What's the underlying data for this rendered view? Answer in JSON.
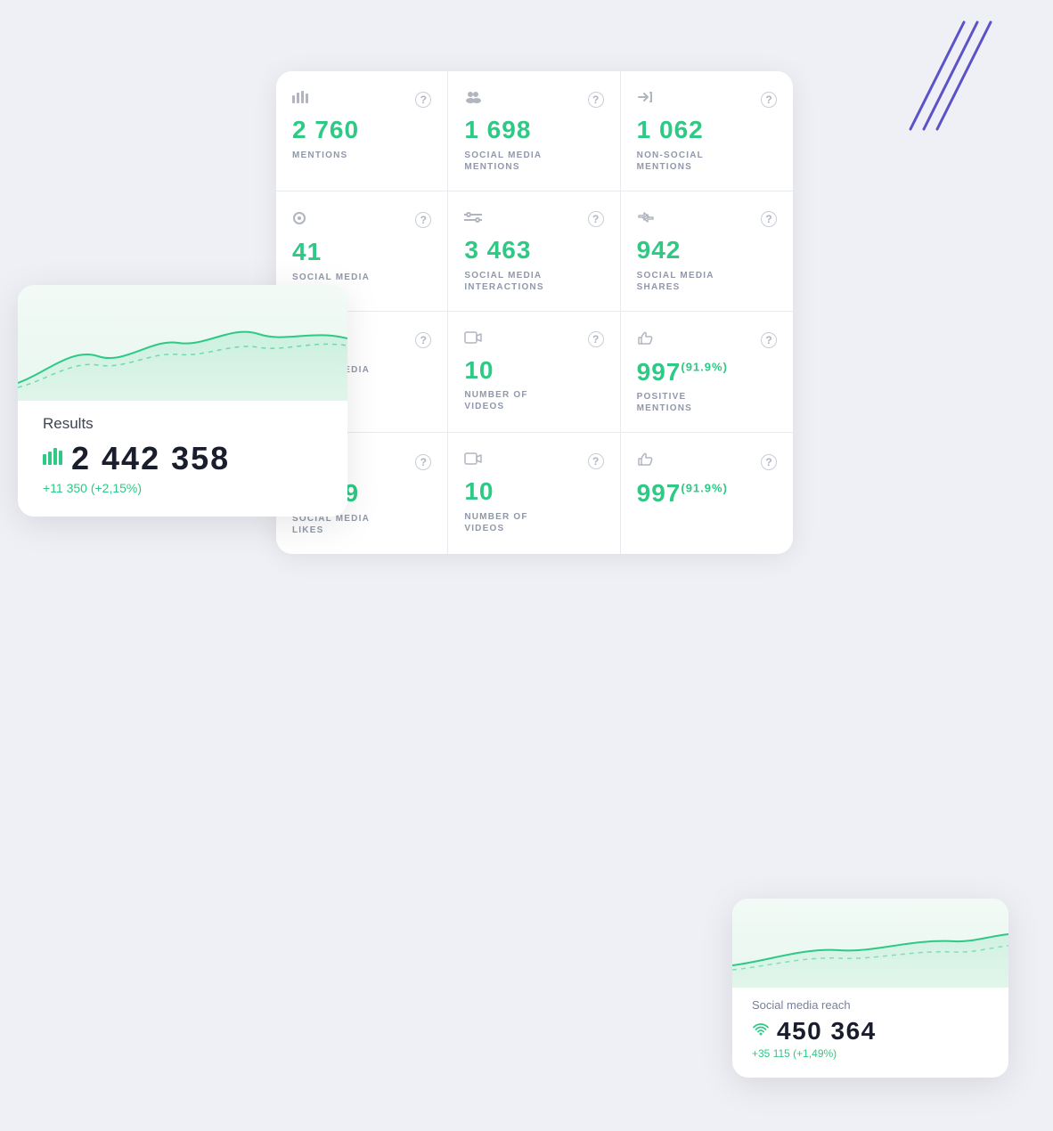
{
  "page": {
    "background_color": "#eef0f6"
  },
  "decorative": {
    "lines_color": "#5b52c8"
  },
  "metrics": [
    {
      "icon": "bar-chart-icon",
      "icon_char": "▦",
      "help": "?",
      "value": "2 760",
      "label": "MENTIONS"
    },
    {
      "icon": "people-icon",
      "icon_char": "👥",
      "help": "?",
      "value": "1 698",
      "label": "SOCIAL MEDIA\nMENTIONS"
    },
    {
      "icon": "share-icon",
      "icon_char": "↗",
      "help": "?",
      "value": "1 062",
      "label": "NON-SOCIAL\nMENTIONS"
    },
    {
      "icon": "circle-icon",
      "icon_char": "◎",
      "help": "?",
      "value": "41",
      "label": "SOCIAL MEDIA",
      "partial": true
    },
    {
      "icon": "filter-icon",
      "icon_char": "⇌",
      "help": "?",
      "value": "3 463",
      "label": "SOCIAL MEDIA\nINTERACTIONS"
    },
    {
      "icon": "retweet-icon",
      "icon_char": "↻",
      "help": "?",
      "value": "942",
      "label": "SOCIAL MEDIA\nSHARES"
    },
    {
      "icon": "dot-icon",
      "icon_char": "•",
      "help": "?",
      "value": "...",
      "label": "SOCIAL MEDIA",
      "partial": true
    },
    {
      "icon": "video-icon",
      "icon_char": "▶",
      "help": "?",
      "value": "10",
      "label": "NUMBER OF\nVIDEOS"
    },
    {
      "icon": "thumb-icon",
      "icon_char": "👍",
      "help": "?",
      "value": "997",
      "value_sup": "(91.9%)",
      "label": "POSITIVE\nMENTIONS"
    },
    {
      "icon": "star-icon",
      "icon_char": "★",
      "help": "?",
      "value": "2 519",
      "label": "SOCIAL MEDIA\nLIKES"
    },
    {
      "icon": "video2-icon",
      "icon_char": "▶",
      "help": "?",
      "value": "10",
      "label": "NUMBER OF\nVIDEOS"
    },
    {
      "icon": "thumb2-icon",
      "icon_char": "👍",
      "help": "?",
      "value": "997",
      "value_sup": "(91.9%)",
      "label": ""
    }
  ],
  "results_widget": {
    "title": "Results",
    "number": "2 442 358",
    "change": "+11 350 (+2,15%)",
    "icon": "bar-chart-green-icon"
  },
  "reach_widget": {
    "title": "Social media reach",
    "number": "450 364",
    "change": "+35 115 (+1,49%)",
    "icon": "wifi-icon"
  }
}
